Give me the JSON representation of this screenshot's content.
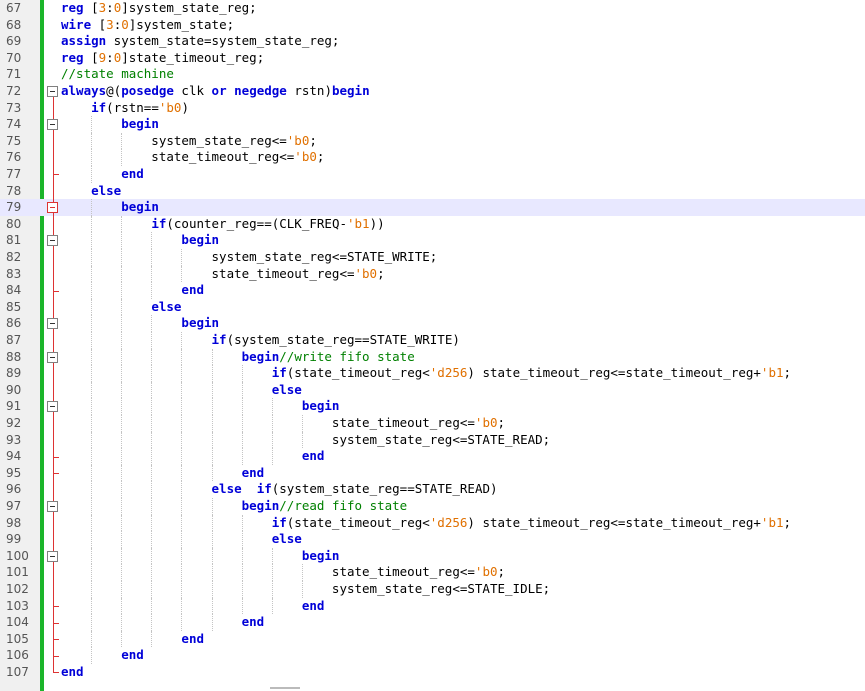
{
  "editor": {
    "first_line_number": 67,
    "current_line_index": 12,
    "lines": [
      "reg [3:0]system_state_reg;",
      "wire [3:0]system_state;",
      "assign system_state=system_state_reg;",
      "reg [9:0]state_timeout_reg;",
      "//state machine",
      "always@(posedge clk or negedge rstn)begin",
      "    if(rstn=='b0)",
      "        begin",
      "            system_state_reg<='b0;",
      "            state_timeout_reg<='b0;",
      "        end",
      "    else",
      "        begin",
      "            if(counter_reg==(CLK_FREQ-'b1))",
      "                begin",
      "                    system_state_reg<=STATE_WRITE;",
      "                    state_timeout_reg<='b0;",
      "                end",
      "            else",
      "                begin",
      "                    if(system_state_reg==STATE_WRITE)",
      "                        begin//write fifo state",
      "                            if(state_timeout_reg<'d256) state_timeout_reg<=state_timeout_reg+'b1;",
      "                            else",
      "                                begin",
      "                                    state_timeout_reg<='b0;",
      "                                    system_state_reg<=STATE_READ;",
      "                                end",
      "                        end",
      "                    else  if(system_state_reg==STATE_READ)",
      "                        begin//read fifo state",
      "                            if(state_timeout_reg<'d256) state_timeout_reg<=state_timeout_reg+'b1;",
      "                            else",
      "                                begin",
      "                                    state_timeout_reg<='b0;",
      "                                    system_state_reg<=STATE_IDLE;",
      "                                end",
      "                        end",
      "                end",
      "        end",
      "end"
    ],
    "line_numbers": [
      "67",
      "68",
      "69",
      "70",
      "71",
      "72",
      "73",
      "74",
      "75",
      "76",
      "77",
      "78",
      "79",
      "80",
      "81",
      "82",
      "83",
      "84",
      "85",
      "86",
      "87",
      "88",
      "89",
      "90",
      "91",
      "92",
      "93",
      "94",
      "95",
      "96",
      "97",
      "98",
      "99",
      "100",
      "101",
      "102",
      "103",
      "104",
      "105",
      "106",
      "107"
    ],
    "fold_start_indices": [
      5,
      7,
      12,
      14,
      19,
      21,
      24,
      30,
      33
    ],
    "fold_end_indices": [
      10,
      17,
      27,
      28,
      36,
      37,
      38,
      39,
      40
    ],
    "colors": {
      "keyword": "#0000d8",
      "number": "#e07000",
      "comment": "#008000",
      "change_bar": "#1bb52a",
      "fold_marker": "#d33",
      "current_line": "#e8e8ff"
    }
  }
}
